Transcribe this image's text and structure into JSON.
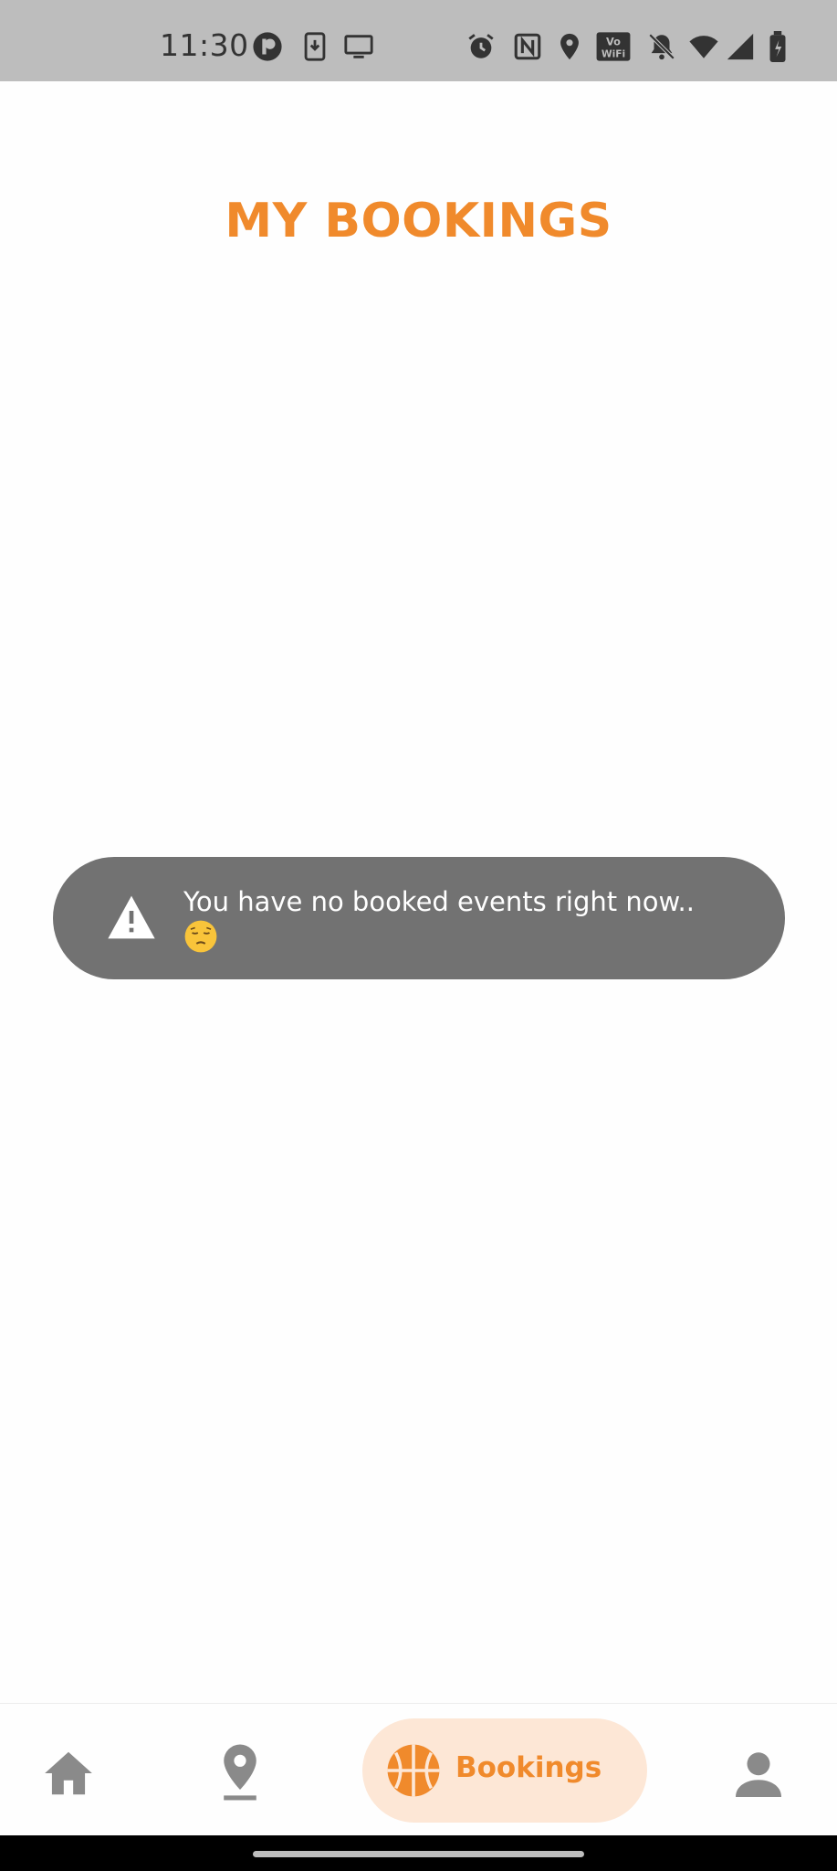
{
  "status_bar": {
    "time": "11:30",
    "icons": [
      "app-notification-icon",
      "download-icon",
      "cast-icon",
      "alarm-icon",
      "nfc-icon",
      "location-icon",
      "vowifi-icon",
      "mute-icon",
      "wifi-icon",
      "signal-icon",
      "battery-icon"
    ]
  },
  "page": {
    "title": "MY BOOKINGS"
  },
  "snackbar": {
    "icon": "warning-icon",
    "message": "You have no booked events right now.."
  },
  "bottom_nav": {
    "items": [
      {
        "icon": "home-icon",
        "label": ""
      },
      {
        "icon": "location-pin-icon",
        "label": ""
      },
      {
        "icon": "basketball-icon",
        "label": "Bookings",
        "selected": true
      },
      {
        "icon": "profile-icon",
        "label": ""
      }
    ]
  },
  "colors": {
    "accent": "#f08a2c",
    "selected_pill": "#fde7d6",
    "snackbar_bg": "#727272",
    "nav_icon": "#8a8a8a"
  }
}
